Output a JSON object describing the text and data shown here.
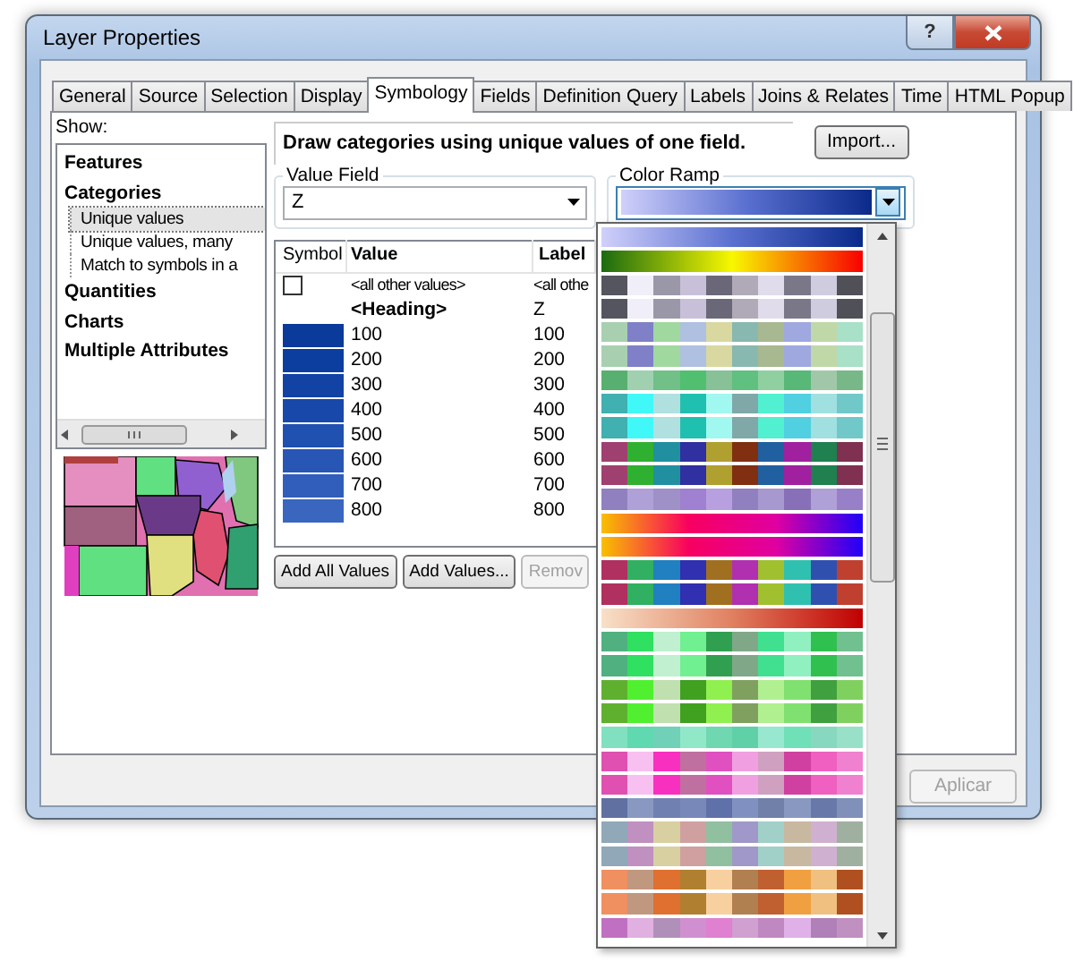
{
  "window": {
    "title": "Layer Properties",
    "help": "?"
  },
  "tabs": [
    {
      "label": "General",
      "selected": false
    },
    {
      "label": "Source",
      "selected": false
    },
    {
      "label": "Selection",
      "selected": false
    },
    {
      "label": "Display",
      "selected": false
    },
    {
      "label": "Symbology",
      "selected": true
    },
    {
      "label": "Fields",
      "selected": false
    },
    {
      "label": "Definition Query",
      "selected": false
    },
    {
      "label": "Labels",
      "selected": false
    },
    {
      "label": "Joins & Relates",
      "selected": false
    },
    {
      "label": "Time",
      "selected": false
    },
    {
      "label": "HTML Popup",
      "selected": false
    }
  ],
  "show": {
    "label": "Show:",
    "items": [
      {
        "label": "Features",
        "selected": false
      },
      {
        "label": "Categories",
        "selected": false,
        "children": [
          {
            "label": "Unique values",
            "selected": true
          },
          {
            "label": "Unique values, many",
            "selected": false
          },
          {
            "label": "Match to symbols in a",
            "selected": false
          }
        ]
      },
      {
        "label": "Quantities",
        "selected": false
      },
      {
        "label": "Charts",
        "selected": false
      },
      {
        "label": "Multiple Attributes",
        "selected": false
      }
    ]
  },
  "description": "Draw categories using unique values of one field.",
  "import_button": "Import...",
  "value_field": {
    "label": "Value Field",
    "value": "Z"
  },
  "color_ramp": {
    "label": "Color Ramp"
  },
  "table": {
    "columns": [
      "Symbol",
      "Value",
      "Label"
    ],
    "rows": [
      {
        "kind": "other",
        "value": "<all other values>",
        "label": "<all othe"
      },
      {
        "kind": "heading",
        "value": "<Heading>",
        "label": "Z"
      },
      {
        "kind": "value",
        "color": "#0a3a9a",
        "value": "100",
        "label": "100"
      },
      {
        "kind": "value",
        "color": "#0c3ea0",
        "value": "200",
        "label": "200"
      },
      {
        "kind": "value",
        "color": "#1242a4",
        "value": "300",
        "label": "300"
      },
      {
        "kind": "value",
        "color": "#1848aa",
        "value": "400",
        "label": "400"
      },
      {
        "kind": "value",
        "color": "#2050b0",
        "value": "500",
        "label": "500"
      },
      {
        "kind": "value",
        "color": "#2856b4",
        "value": "600",
        "label": "600"
      },
      {
        "kind": "value",
        "color": "#305eba",
        "value": "700",
        "label": "700"
      },
      {
        "kind": "value",
        "color": "#3a66c0",
        "value": "800",
        "label": "800"
      }
    ]
  },
  "table_buttons": [
    {
      "label": "Add All Values",
      "disabled": false
    },
    {
      "label": "Add Values...",
      "disabled": false
    },
    {
      "label": "Remov",
      "disabled": true
    }
  ],
  "dialog_buttons": [
    {
      "label": "Aplicar",
      "disabled": true
    }
  ]
}
